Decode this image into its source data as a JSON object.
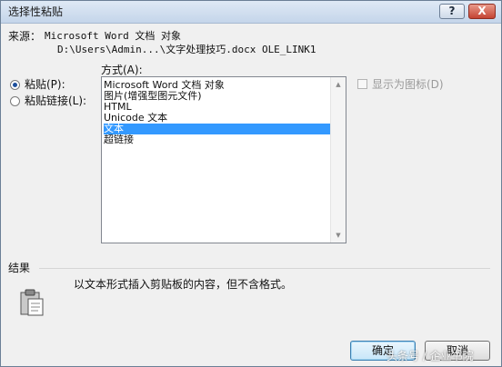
{
  "window": {
    "title": "选择性粘贴",
    "help_label": "?",
    "close_label": "X"
  },
  "source": {
    "label": "来源：",
    "line1": "Microsoft Word 文档 对象",
    "line2": "D:\\Users\\Admin...\\文字处理技巧.docx OLE_LINK1"
  },
  "as_label": "方式(A):",
  "options": {
    "paste_label": "粘贴(P):",
    "paste_link_label": "粘贴链接(L):",
    "selected": "paste"
  },
  "formats": {
    "items": [
      "Microsoft Word 文档 对象",
      "图片(增强型图元文件)",
      "HTML",
      "Unicode 文本",
      "文本",
      "超链接"
    ],
    "selected_index": 4
  },
  "display_as_icon_label": "显示为图标(D)",
  "result": {
    "label": "结果",
    "description": "以文本形式插入剪贴板的内容，但不含格式。"
  },
  "buttons": {
    "ok": "确定",
    "cancel": "取消"
  },
  "watermark": "头条号 / 企业书院",
  "colors": {
    "selection": "#3399ff",
    "title_gradient_top": "#dfe9f5",
    "close_button": "#c44332"
  },
  "icons": {
    "result_icon": "clipboard-icon",
    "scroll_up": "scroll-up-icon",
    "scroll_down": "scroll-down-icon"
  }
}
